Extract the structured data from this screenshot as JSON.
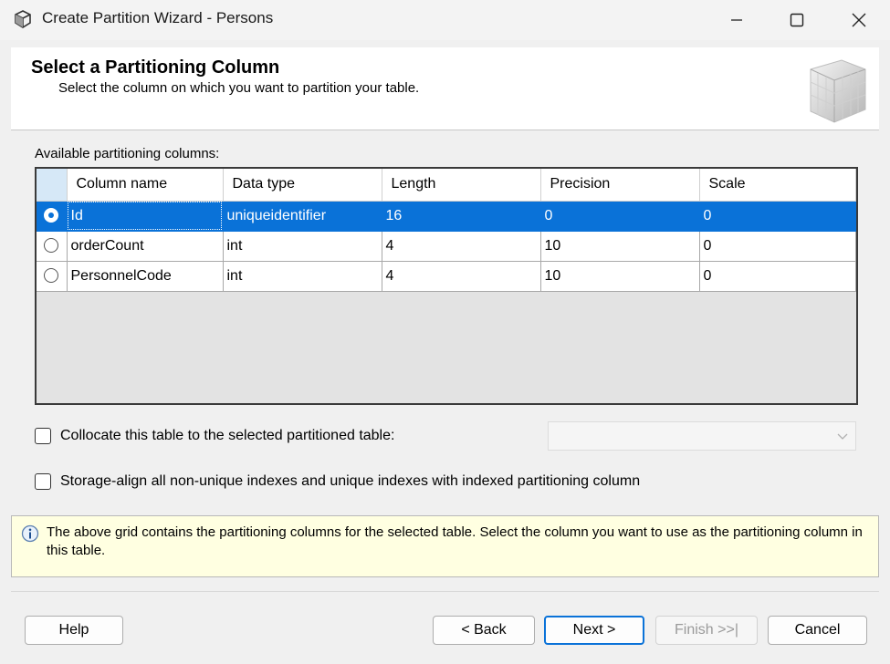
{
  "window": {
    "title": "Create Partition Wizard - Persons",
    "icons": [
      "app-cube-icon",
      "minimize-icon",
      "maximize-icon",
      "close-icon"
    ]
  },
  "header": {
    "title": "Select a Partitioning Column",
    "subtitle": "Select the column on which you want to partition your table."
  },
  "grid": {
    "label": "Available partitioning columns:",
    "columns": [
      "Column name",
      "Data type",
      "Length",
      "Precision",
      "Scale"
    ],
    "rows": [
      {
        "name": "Id",
        "type": "uniqueidentifier",
        "length": "16",
        "precision": "0",
        "scale": "0",
        "selected": true
      },
      {
        "name": "orderCount",
        "type": "int",
        "length": "4",
        "precision": "10",
        "scale": "0",
        "selected": false
      },
      {
        "name": "PersonnelCode",
        "type": "int",
        "length": "4",
        "precision": "10",
        "scale": "0",
        "selected": false
      }
    ]
  },
  "options": {
    "collocate_label": "Collocate this table to the selected partitioned table:",
    "collocate_checked": false,
    "collocate_value": "",
    "storage_align_label": "Storage-align all non-unique indexes and unique indexes with indexed partitioning column",
    "storage_align_checked": false
  },
  "info": {
    "icon": "info-icon",
    "text": "The above grid contains the partitioning columns for the selected table. Select the column you want to use as the partitioning column in this table."
  },
  "buttons": {
    "help": "Help",
    "back": "< Back",
    "next": "Next >",
    "finish": "Finish >>|",
    "cancel": "Cancel"
  },
  "colors": {
    "selection": "#0a72d8",
    "info_background": "#ffffe1",
    "window_background": "#f0f0f0"
  }
}
